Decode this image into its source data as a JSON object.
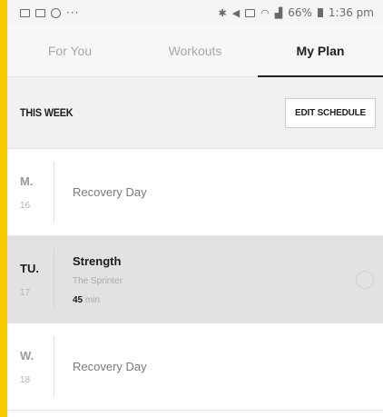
{
  "status_bar": {
    "dots": "···",
    "time": "1:36 pm",
    "battery": "66%",
    "left_icons": [
      "gallery-icon",
      "calendar-icon",
      "chrome-icon"
    ],
    "right_icons": [
      "bluetooth-icon",
      "mute-icon",
      "nfc-icon",
      "wifi-icon",
      "signal-icon",
      "battery-icon"
    ]
  },
  "tabs": [
    {
      "label": "For You",
      "active": false
    },
    {
      "label": "Workouts",
      "active": false
    },
    {
      "label": "My Plan",
      "active": true
    }
  ],
  "week": {
    "title": "THIS WEEK",
    "edit_label": "EDIT SCHEDULE"
  },
  "days": [
    {
      "abbr": "M.",
      "num": "16",
      "title": "Recovery Day"
    },
    {
      "abbr": "TU.",
      "num": "17",
      "title": "Strength",
      "subtitle": "The Sprinter",
      "duration": "45",
      "duration_unit": "min"
    },
    {
      "abbr": "W.",
      "num": "18",
      "title": "Recovery Day"
    }
  ],
  "colors": {
    "frame": "#f5c800",
    "selected_row": "#e2e2e2",
    "active_tab_underline": "#222222"
  }
}
